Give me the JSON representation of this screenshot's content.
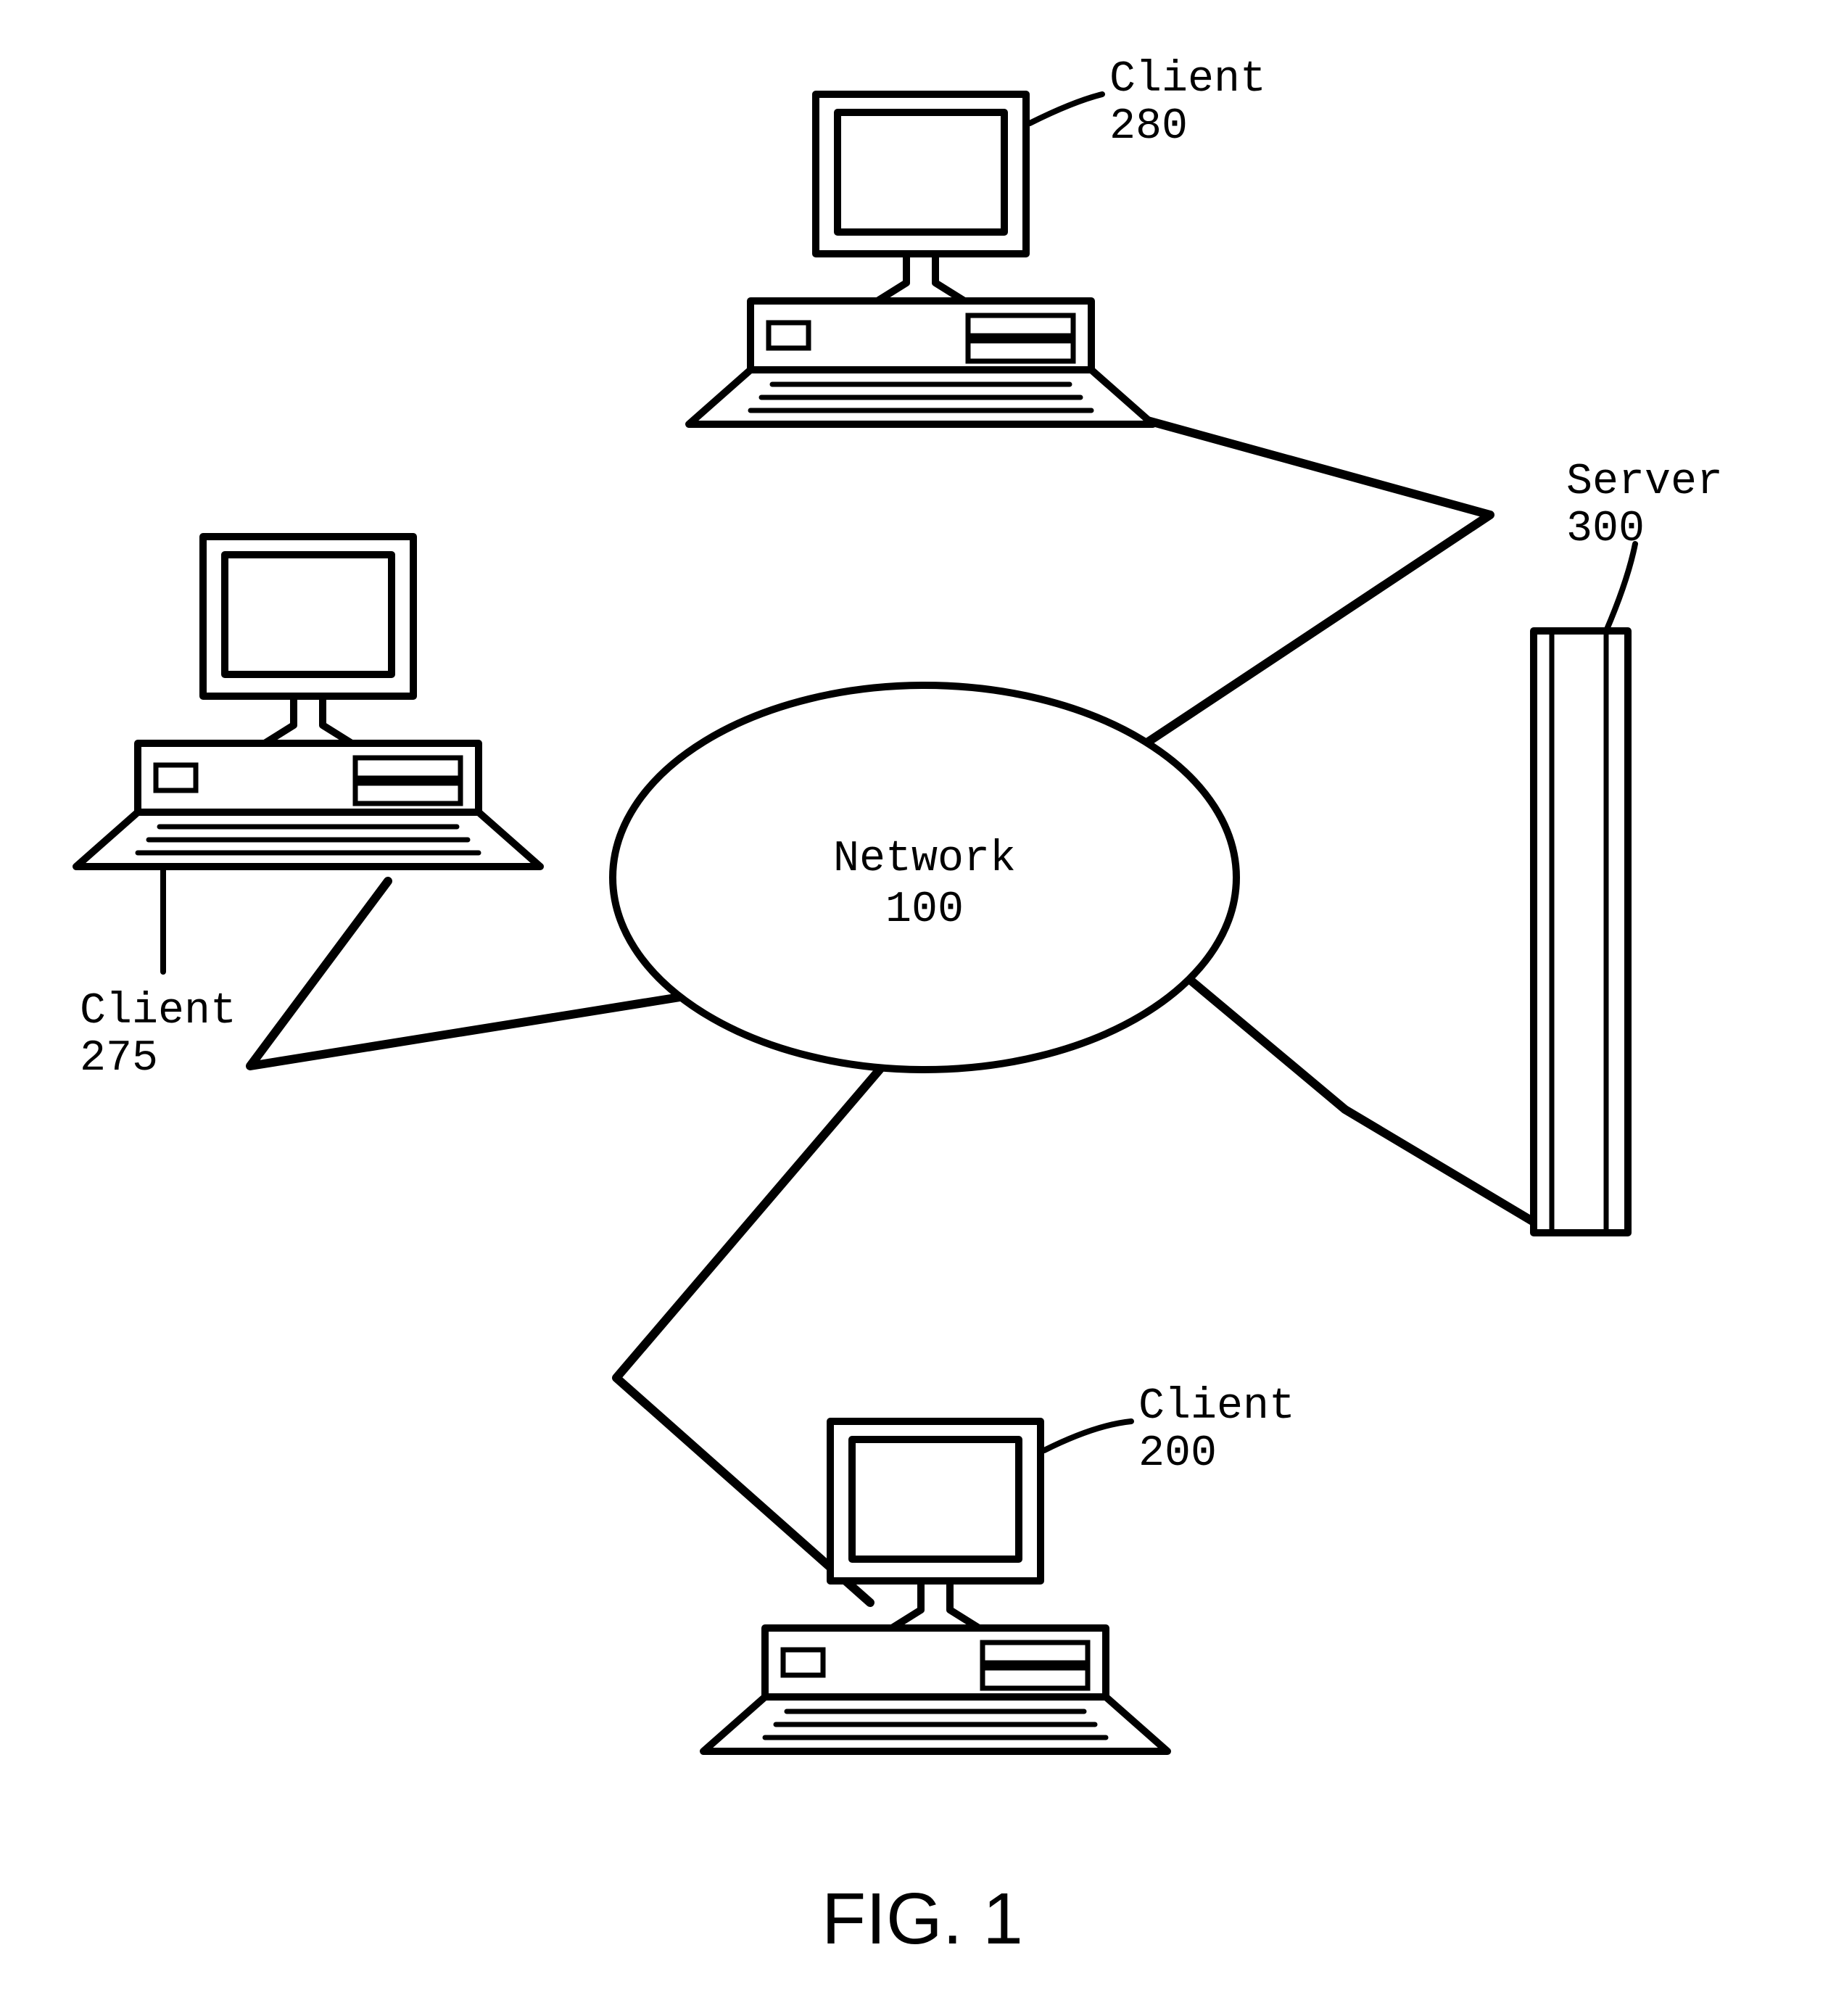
{
  "figure_label": "FIG. 1",
  "network": {
    "title": "Network",
    "ref": "100"
  },
  "client_top": {
    "title": "Client",
    "ref": "280"
  },
  "client_left": {
    "title": "Client",
    "ref": "275"
  },
  "client_bottom": {
    "title": "Client",
    "ref": "200"
  },
  "server": {
    "title": "Server",
    "ref": "300"
  }
}
